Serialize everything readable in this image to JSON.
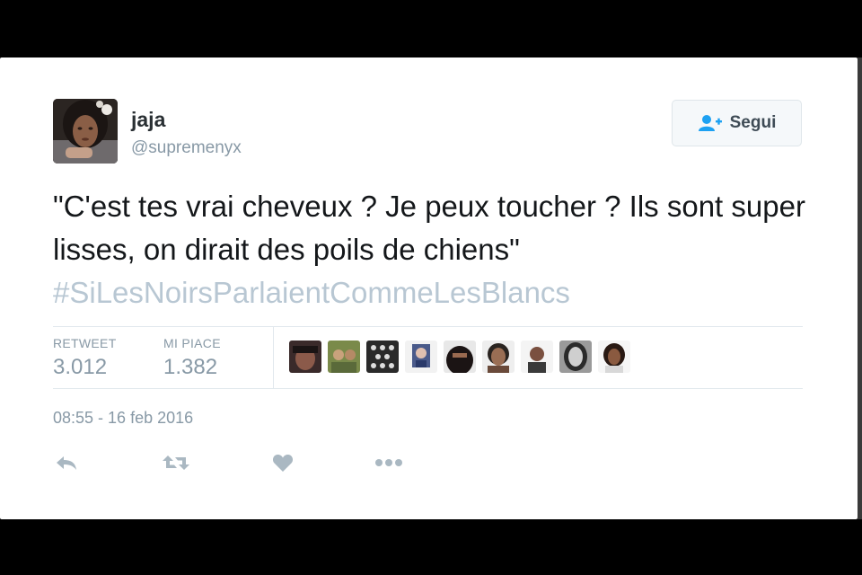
{
  "tweet": {
    "author_name": "jaja",
    "author_handle": "@supremenyx",
    "follow_label": "Segui",
    "text": "\"C'est tes vrai cheveux ? Je peux toucher ? Ils sont super lisses, on dirait des poils de chiens\"",
    "hashtag": "#SiLesNoirsParlaientCommeLesBlancs",
    "retweet_label": "RETWEET",
    "retweet_count": "3.012",
    "likes_label": "MI PIACE",
    "likes_count": "1.382",
    "timestamp": "08:55 - 16 feb 2016",
    "liker_avatars": [
      "avatar",
      "avatar",
      "avatar",
      "avatar",
      "avatar",
      "avatar",
      "avatar",
      "avatar",
      "avatar"
    ]
  },
  "icons": {
    "follow": "follow-user-icon",
    "reply": "reply-icon",
    "retweet": "retweet-icon",
    "like": "heart-icon",
    "more": "more-dots-icon"
  },
  "colors": {
    "text": "#14171a",
    "muted": "#8899a6",
    "hashtag": "#b8c7d3",
    "follow_icon": "#1da1f2"
  }
}
